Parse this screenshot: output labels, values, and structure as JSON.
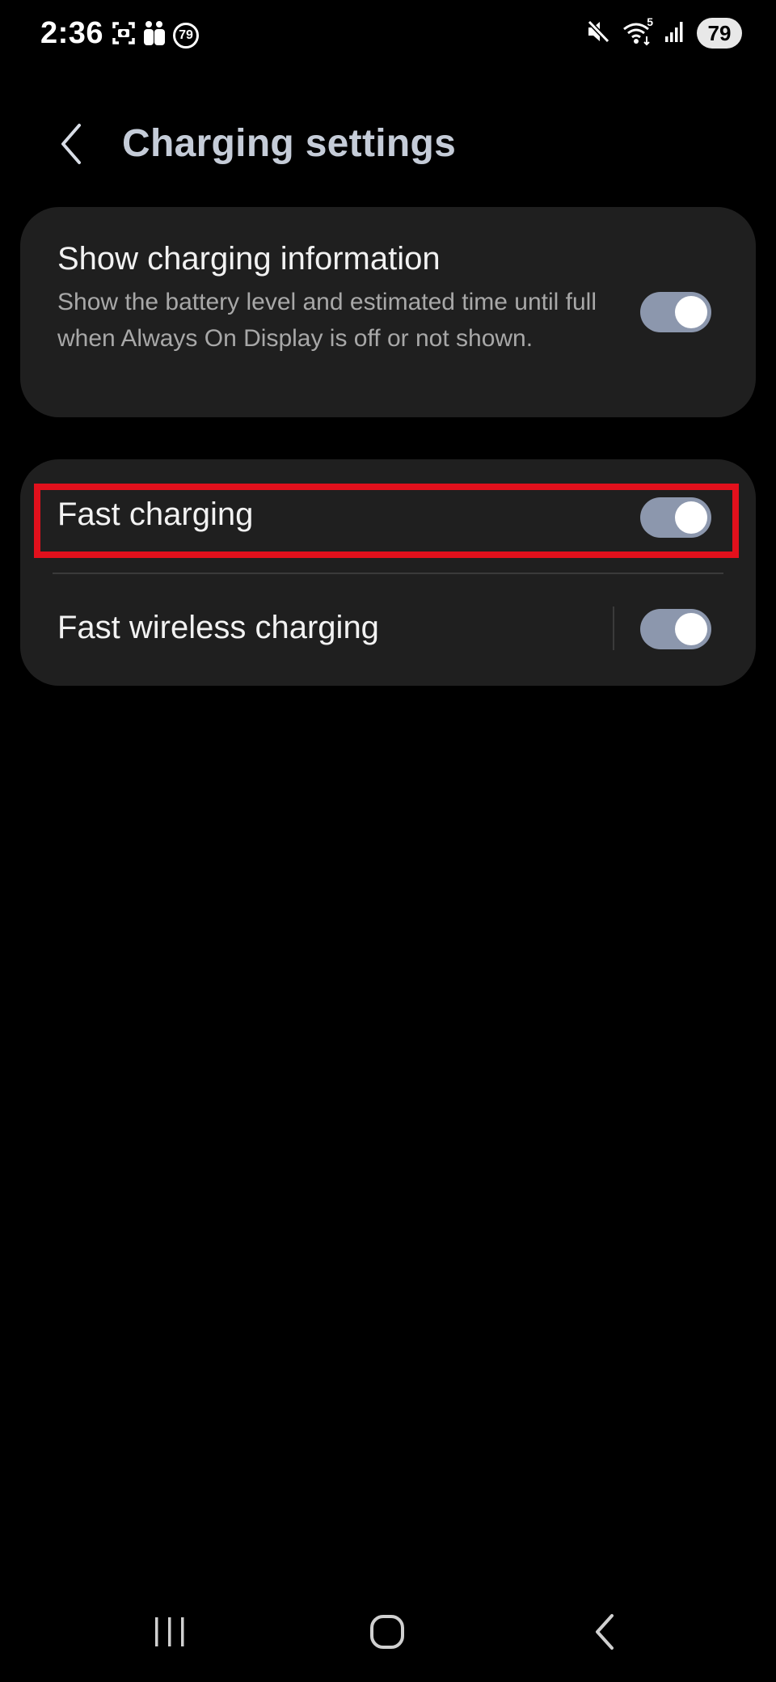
{
  "status_bar": {
    "time": "2:36",
    "left_icons": [
      "screenshot-icon",
      "family-icon",
      "notification-count-icon"
    ],
    "notification_count": "79",
    "right_icons": [
      "mute-icon",
      "wifi-icon",
      "signal-icon"
    ],
    "wifi_label": "5",
    "battery": "79"
  },
  "header": {
    "title": "Charging settings",
    "back_icon": "chevron-left-icon"
  },
  "settings": {
    "show_info": {
      "title": "Show charging information",
      "summary": "Show the battery level and estimated time until full when Always On Display is off or not shown.",
      "enabled": true
    },
    "fast_charging": {
      "title": "Fast charging",
      "enabled": true
    },
    "fast_wireless": {
      "title": "Fast wireless charging",
      "enabled": true
    }
  },
  "highlight_color": "#e2101c",
  "accent_color": "#8c97ad",
  "nav_bar": {
    "buttons": [
      "recents-icon",
      "home-icon",
      "back-icon"
    ]
  }
}
